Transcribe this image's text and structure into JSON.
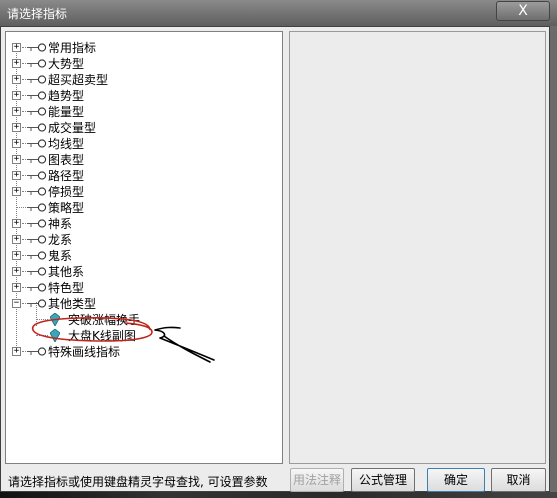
{
  "window": {
    "title": "请选择指标",
    "close_label": "X"
  },
  "tree": {
    "items": [
      {
        "label": "常用指标",
        "expandable": true
      },
      {
        "label": "大势型",
        "expandable": true
      },
      {
        "label": "超买超卖型",
        "expandable": true
      },
      {
        "label": "趋势型",
        "expandable": true
      },
      {
        "label": "能量型",
        "expandable": true
      },
      {
        "label": "成交量型",
        "expandable": true
      },
      {
        "label": "均线型",
        "expandable": true
      },
      {
        "label": "图表型",
        "expandable": true
      },
      {
        "label": "路径型",
        "expandable": true
      },
      {
        "label": "停损型",
        "expandable": true
      },
      {
        "label": "策略型",
        "expandable": false
      },
      {
        "label": "神系",
        "expandable": true
      },
      {
        "label": "龙系",
        "expandable": true
      },
      {
        "label": "鬼系",
        "expandable": true
      },
      {
        "label": "其他系",
        "expandable": true
      },
      {
        "label": "特色型",
        "expandable": true
      },
      {
        "label": "其他类型",
        "expandable": true,
        "expanded": true
      },
      {
        "label": "突破涨幅换手",
        "leaf": true
      },
      {
        "label": "大盘K线副图",
        "leaf": true
      },
      {
        "label": "特殊画线指标",
        "expandable": true
      }
    ]
  },
  "status_text": "请选择指标或使用键盘精灵字母查找, 可设置参数",
  "buttons": {
    "usage": "用法注释",
    "formula_manage": "公式管理",
    "ok": "确定",
    "cancel": "取消"
  },
  "colors": {
    "annotation_circle": "#c0241c",
    "annotation_arrow": "#000000",
    "leaf_icon": "#3aa6b9"
  },
  "icons": {
    "expand": "plus-box-icon",
    "node": "key-node-icon",
    "leaf": "gem-icon"
  }
}
